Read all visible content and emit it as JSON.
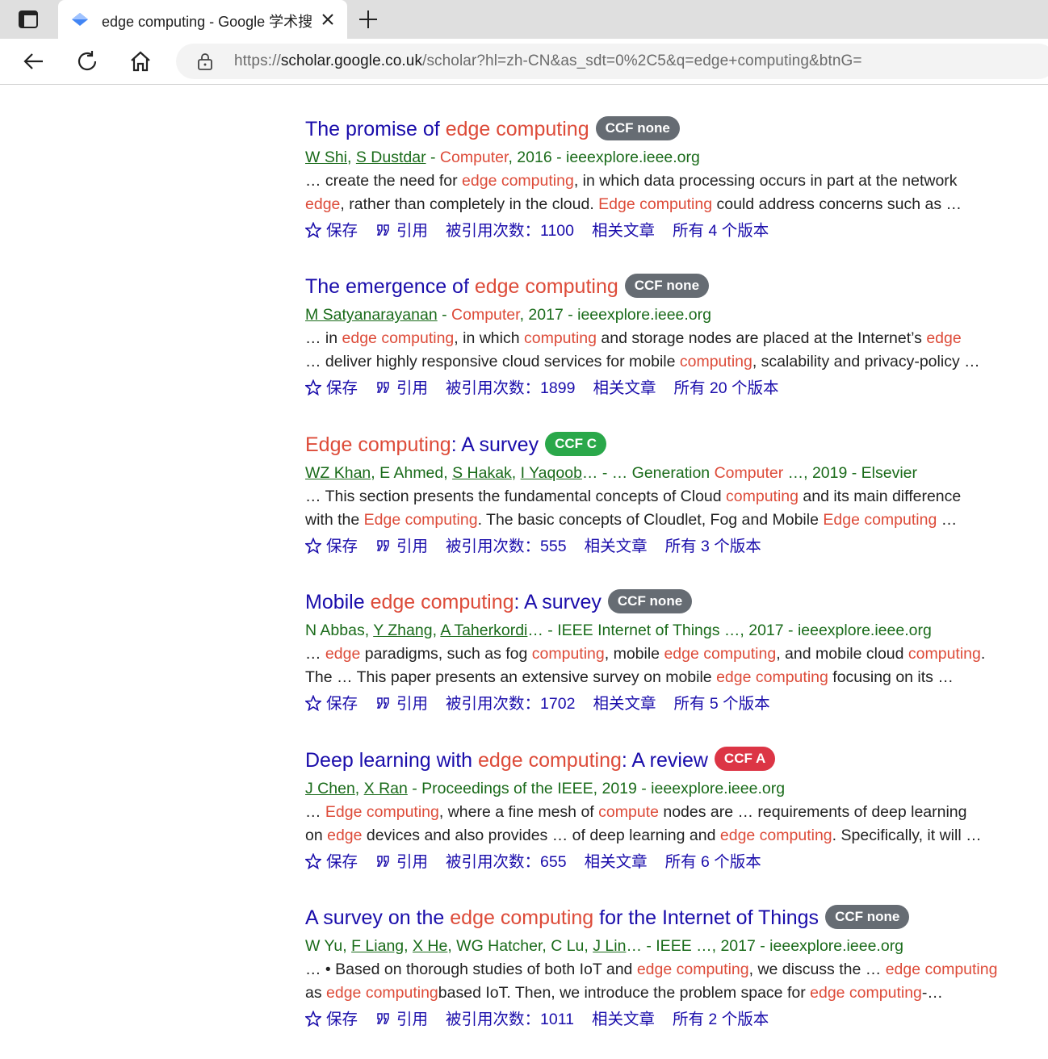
{
  "browser": {
    "tab_title": "edge computing - Google 学术搜索",
    "url_prefix": "https://",
    "url_host": "scholar.google.co.uk",
    "url_path": "/scholar?hl=zh-CN&as_sdt=0%2C5&q=edge+computing&btnG="
  },
  "actions": {
    "save": "保存",
    "cite": "引用",
    "cited_prefix": "被引用次数：",
    "related": "相关文章",
    "versions_prefix": "所有 ",
    "versions_suffix": " 个版本"
  },
  "colors": {
    "title": "#1a0dab",
    "highlight": "#dd4b39",
    "meta": "#1a6b1a",
    "badge_none": "#666c73",
    "badge_c": "#2aa84a",
    "badge_a": "#dc3545"
  },
  "results": [
    {
      "title": [
        [
          "The promise of ",
          false
        ],
        [
          "edge computing",
          true
        ]
      ],
      "badge": "CCF none",
      "badge_type": "none",
      "meta": [
        [
          "W Shi",
          "author"
        ],
        [
          ", ",
          "plain"
        ],
        [
          "S Dustdar",
          "author"
        ],
        [
          " - ",
          "plain"
        ],
        [
          "Computer",
          "hl"
        ],
        [
          ", 2016 - ieeexplore.ieee.org",
          "plain"
        ]
      ],
      "snippet": [
        [
          [
            "… create the need for ",
            false
          ],
          [
            "edge computing",
            true
          ],
          [
            ", in which data processing occurs in part at the network",
            false
          ]
        ],
        [
          [
            "edge",
            true
          ],
          [
            ", rather than completely in the cloud. ",
            false
          ],
          [
            "Edge computing",
            true
          ],
          [
            " could address concerns such as …",
            false
          ]
        ]
      ],
      "cited": "1100",
      "versions": "4"
    },
    {
      "title": [
        [
          "The emergence of ",
          false
        ],
        [
          "edge computing",
          true
        ]
      ],
      "badge": "CCF none",
      "badge_type": "none",
      "meta": [
        [
          "M Satyanarayanan",
          "author"
        ],
        [
          " - ",
          "plain"
        ],
        [
          "Computer",
          "hl"
        ],
        [
          ", 2017 - ieeexplore.ieee.org",
          "plain"
        ]
      ],
      "snippet": [
        [
          [
            "… in ",
            false
          ],
          [
            "edge computing",
            true
          ],
          [
            ", in which ",
            false
          ],
          [
            "computing",
            true
          ],
          [
            " and storage nodes are placed at the Internet’s ",
            false
          ],
          [
            "edge",
            true
          ]
        ],
        [
          [
            "… deliver highly responsive cloud services for mobile ",
            false
          ],
          [
            "computing",
            true
          ],
          [
            ", scalability and privacy-policy …",
            false
          ]
        ]
      ],
      "cited": "1899",
      "versions": "20"
    },
    {
      "title": [
        [
          "Edge computing",
          true
        ],
        [
          ": A survey",
          false
        ]
      ],
      "badge": "CCF C",
      "badge_type": "c",
      "meta": [
        [
          "WZ Khan",
          "author"
        ],
        [
          ", E Ahmed, ",
          "plain"
        ],
        [
          "S Hakak",
          "author"
        ],
        [
          ", ",
          "plain"
        ],
        [
          "I Yaqoob",
          "author"
        ],
        [
          "… - … Generation ",
          "plain"
        ],
        [
          "Computer",
          "hl"
        ],
        [
          " …, 2019 - Elsevier",
          "plain"
        ]
      ],
      "snippet": [
        [
          [
            "… This section presents the fundamental concepts of Cloud ",
            false
          ],
          [
            "computing",
            true
          ],
          [
            " and its main difference",
            false
          ]
        ],
        [
          [
            "with the ",
            false
          ],
          [
            "Edge computing",
            true
          ],
          [
            ". The basic concepts of Cloudlet, Fog and Mobile ",
            false
          ],
          [
            "Edge computing",
            true
          ],
          [
            " …",
            false
          ]
        ]
      ],
      "cited": "555",
      "versions": "3"
    },
    {
      "title": [
        [
          "Mobile ",
          false
        ],
        [
          "edge computing",
          true
        ],
        [
          ": A survey",
          false
        ]
      ],
      "badge": "CCF none",
      "badge_type": "none",
      "meta": [
        [
          "N Abbas, ",
          "plain"
        ],
        [
          "Y Zhang",
          "author"
        ],
        [
          ", ",
          "plain"
        ],
        [
          "A Taherkordi",
          "author"
        ],
        [
          "… - IEEE Internet of Things …, 2017 - ieeexplore.ieee.org",
          "plain"
        ]
      ],
      "snippet": [
        [
          [
            "… ",
            false
          ],
          [
            "edge",
            true
          ],
          [
            " paradigms, such as fog ",
            false
          ],
          [
            "computing",
            true
          ],
          [
            ", mobile ",
            false
          ],
          [
            "edge computing",
            true
          ],
          [
            ", and mobile cloud ",
            false
          ],
          [
            "computing",
            true
          ],
          [
            ".",
            false
          ]
        ],
        [
          [
            "The … This paper presents an extensive survey on mobile ",
            false
          ],
          [
            "edge computing",
            true
          ],
          [
            " focusing on its …",
            false
          ]
        ]
      ],
      "cited": "1702",
      "versions": "5"
    },
    {
      "title": [
        [
          "Deep learning with ",
          false
        ],
        [
          "edge computing",
          true
        ],
        [
          ": A review",
          false
        ]
      ],
      "badge": "CCF A",
      "badge_type": "a",
      "meta": [
        [
          "J Chen",
          "author"
        ],
        [
          ", ",
          "plain"
        ],
        [
          "X Ran",
          "author"
        ],
        [
          " - Proceedings of the IEEE, 2019 - ieeexplore.ieee.org",
          "plain"
        ]
      ],
      "snippet": [
        [
          [
            "… ",
            false
          ],
          [
            "Edge computing",
            true
          ],
          [
            ", where a fine mesh of ",
            false
          ],
          [
            "compute",
            true
          ],
          [
            " nodes are … requirements of deep learning",
            false
          ]
        ],
        [
          [
            "on ",
            false
          ],
          [
            "edge",
            true
          ],
          [
            " devices and also provides … of deep learning and ",
            false
          ],
          [
            "edge computing",
            true
          ],
          [
            ". Specifically, it will …",
            false
          ]
        ]
      ],
      "cited": "655",
      "versions": "6"
    },
    {
      "title": [
        [
          "A survey on the ",
          false
        ],
        [
          "edge computing",
          true
        ],
        [
          " for the Internet of Things",
          false
        ]
      ],
      "badge": "CCF none",
      "badge_type": "none",
      "meta": [
        [
          "W Yu, ",
          "plain"
        ],
        [
          "F Liang",
          "author"
        ],
        [
          ", ",
          "plain"
        ],
        [
          "X He",
          "author"
        ],
        [
          ", WG Hatcher, C Lu, ",
          "plain"
        ],
        [
          "J Lin",
          "author"
        ],
        [
          "… - IEEE …, 2017 - ieeexplore.ieee.org",
          "plain"
        ]
      ],
      "snippet": [
        [
          [
            "… • Based on thorough studies of both IoT and ",
            false
          ],
          [
            "edge computing",
            true
          ],
          [
            ", we discuss the … ",
            false
          ],
          [
            "edge computing",
            true
          ]
        ],
        [
          [
            "as ",
            false
          ],
          [
            "edge computing",
            true
          ],
          [
            "based IoT. Then, we introduce the problem space for ",
            false
          ],
          [
            "edge computing",
            true
          ],
          [
            "-…",
            false
          ]
        ]
      ],
      "cited": "1011",
      "versions": "2"
    }
  ]
}
